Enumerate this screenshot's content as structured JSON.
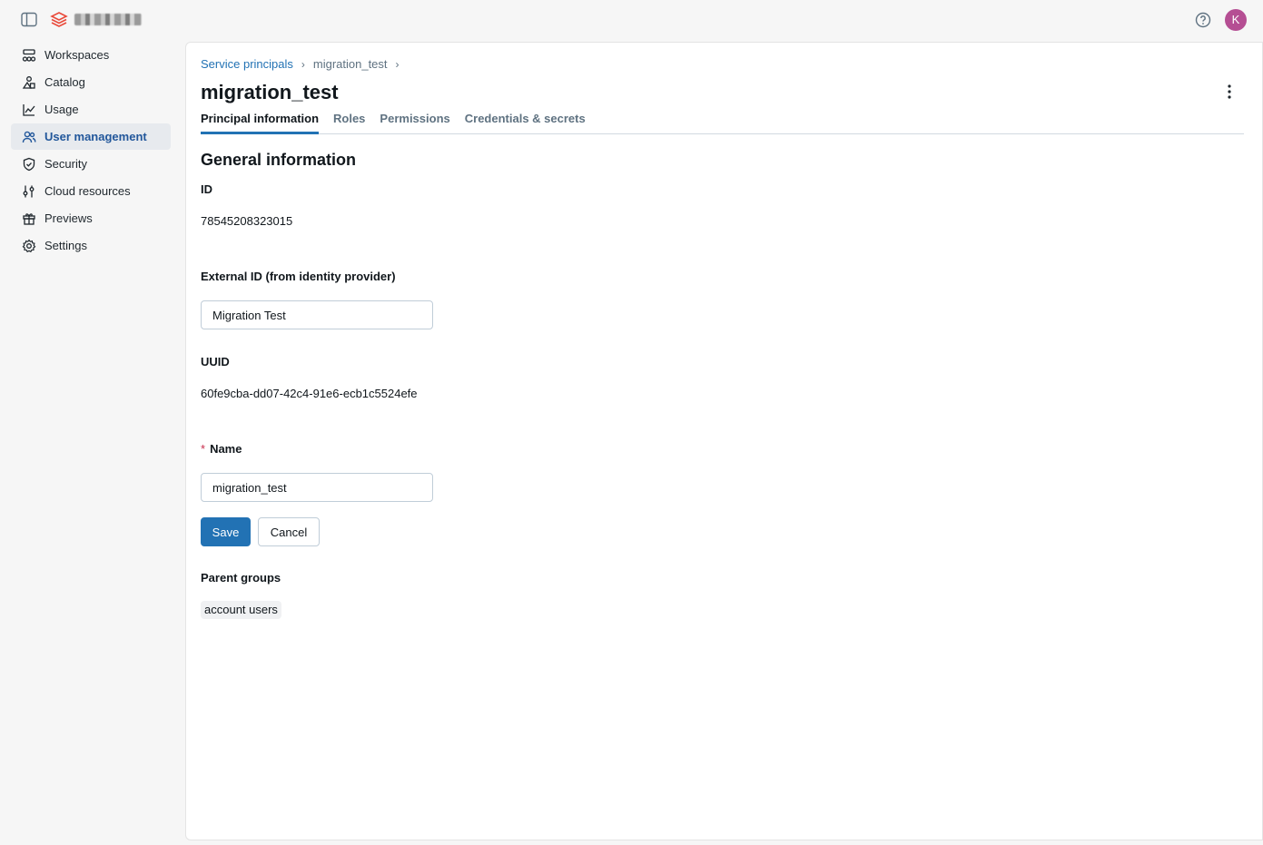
{
  "topbar": {
    "account_name": "workspace",
    "avatar_initial": "K"
  },
  "sidebar": {
    "items": [
      {
        "label": "Workspaces",
        "icon": "workspaces-icon"
      },
      {
        "label": "Catalog",
        "icon": "catalog-icon"
      },
      {
        "label": "Usage",
        "icon": "usage-chart-icon"
      },
      {
        "label": "User management",
        "icon": "users-icon",
        "active": true
      },
      {
        "label": "Security",
        "icon": "shield-icon"
      },
      {
        "label": "Cloud resources",
        "icon": "cloud-resources-icon"
      },
      {
        "label": "Previews",
        "icon": "gift-icon"
      },
      {
        "label": "Settings",
        "icon": "gear-icon"
      }
    ]
  },
  "breadcrumb": {
    "root": "Service principals",
    "current": "migration_test",
    "separator": "›"
  },
  "page": {
    "title": "migration_test"
  },
  "tabs": [
    {
      "label": "Principal information",
      "active": true
    },
    {
      "label": "Roles"
    },
    {
      "label": "Permissions"
    },
    {
      "label": "Credentials & secrets"
    }
  ],
  "general": {
    "section_title": "General information",
    "id_label": "ID",
    "id_value": "78545208323015",
    "external_id_label": "External ID (from identity provider)",
    "external_id_value": "Migration Test",
    "uuid_label": "UUID",
    "uuid_value": "60fe9cba-dd07-42c4-91e6-ecb1c5524efe",
    "name_required_mark": "*",
    "name_label": "Name",
    "name_value": "migration_test",
    "save_label": "Save",
    "cancel_label": "Cancel",
    "parent_groups_label": "Parent groups",
    "parent_groups": [
      "account users"
    ]
  },
  "colors": {
    "accent": "#2272b4",
    "active_nav_bg": "#e7eaee",
    "avatar_bg": "#b54e93"
  }
}
